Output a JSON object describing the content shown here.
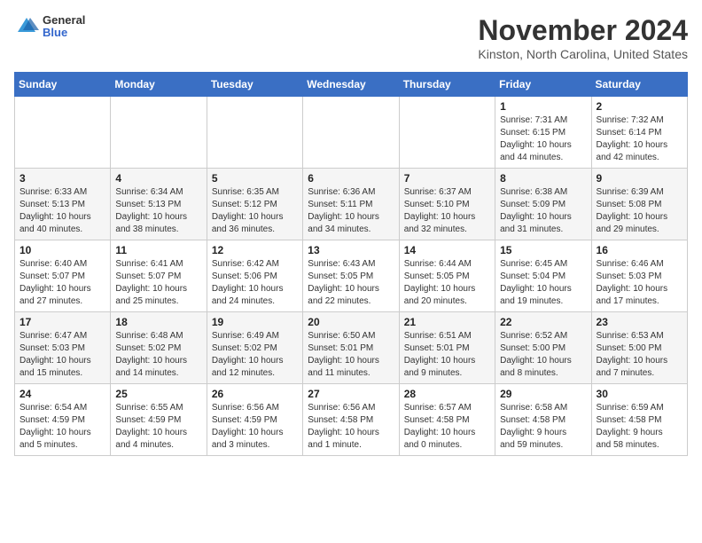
{
  "header": {
    "logo_general": "General",
    "logo_blue": "Blue",
    "title": "November 2024",
    "location": "Kinston, North Carolina, United States"
  },
  "days_of_week": [
    "Sunday",
    "Monday",
    "Tuesday",
    "Wednesday",
    "Thursday",
    "Friday",
    "Saturday"
  ],
  "weeks": [
    [
      {
        "day": "",
        "info": ""
      },
      {
        "day": "",
        "info": ""
      },
      {
        "day": "",
        "info": ""
      },
      {
        "day": "",
        "info": ""
      },
      {
        "day": "",
        "info": ""
      },
      {
        "day": "1",
        "info": "Sunrise: 7:31 AM\nSunset: 6:15 PM\nDaylight: 10 hours\nand 44 minutes."
      },
      {
        "day": "2",
        "info": "Sunrise: 7:32 AM\nSunset: 6:14 PM\nDaylight: 10 hours\nand 42 minutes."
      }
    ],
    [
      {
        "day": "3",
        "info": "Sunrise: 6:33 AM\nSunset: 5:13 PM\nDaylight: 10 hours\nand 40 minutes."
      },
      {
        "day": "4",
        "info": "Sunrise: 6:34 AM\nSunset: 5:13 PM\nDaylight: 10 hours\nand 38 minutes."
      },
      {
        "day": "5",
        "info": "Sunrise: 6:35 AM\nSunset: 5:12 PM\nDaylight: 10 hours\nand 36 minutes."
      },
      {
        "day": "6",
        "info": "Sunrise: 6:36 AM\nSunset: 5:11 PM\nDaylight: 10 hours\nand 34 minutes."
      },
      {
        "day": "7",
        "info": "Sunrise: 6:37 AM\nSunset: 5:10 PM\nDaylight: 10 hours\nand 32 minutes."
      },
      {
        "day": "8",
        "info": "Sunrise: 6:38 AM\nSunset: 5:09 PM\nDaylight: 10 hours\nand 31 minutes."
      },
      {
        "day": "9",
        "info": "Sunrise: 6:39 AM\nSunset: 5:08 PM\nDaylight: 10 hours\nand 29 minutes."
      }
    ],
    [
      {
        "day": "10",
        "info": "Sunrise: 6:40 AM\nSunset: 5:07 PM\nDaylight: 10 hours\nand 27 minutes."
      },
      {
        "day": "11",
        "info": "Sunrise: 6:41 AM\nSunset: 5:07 PM\nDaylight: 10 hours\nand 25 minutes."
      },
      {
        "day": "12",
        "info": "Sunrise: 6:42 AM\nSunset: 5:06 PM\nDaylight: 10 hours\nand 24 minutes."
      },
      {
        "day": "13",
        "info": "Sunrise: 6:43 AM\nSunset: 5:05 PM\nDaylight: 10 hours\nand 22 minutes."
      },
      {
        "day": "14",
        "info": "Sunrise: 6:44 AM\nSunset: 5:05 PM\nDaylight: 10 hours\nand 20 minutes."
      },
      {
        "day": "15",
        "info": "Sunrise: 6:45 AM\nSunset: 5:04 PM\nDaylight: 10 hours\nand 19 minutes."
      },
      {
        "day": "16",
        "info": "Sunrise: 6:46 AM\nSunset: 5:03 PM\nDaylight: 10 hours\nand 17 minutes."
      }
    ],
    [
      {
        "day": "17",
        "info": "Sunrise: 6:47 AM\nSunset: 5:03 PM\nDaylight: 10 hours\nand 15 minutes."
      },
      {
        "day": "18",
        "info": "Sunrise: 6:48 AM\nSunset: 5:02 PM\nDaylight: 10 hours\nand 14 minutes."
      },
      {
        "day": "19",
        "info": "Sunrise: 6:49 AM\nSunset: 5:02 PM\nDaylight: 10 hours\nand 12 minutes."
      },
      {
        "day": "20",
        "info": "Sunrise: 6:50 AM\nSunset: 5:01 PM\nDaylight: 10 hours\nand 11 minutes."
      },
      {
        "day": "21",
        "info": "Sunrise: 6:51 AM\nSunset: 5:01 PM\nDaylight: 10 hours\nand 9 minutes."
      },
      {
        "day": "22",
        "info": "Sunrise: 6:52 AM\nSunset: 5:00 PM\nDaylight: 10 hours\nand 8 minutes."
      },
      {
        "day": "23",
        "info": "Sunrise: 6:53 AM\nSunset: 5:00 PM\nDaylight: 10 hours\nand 7 minutes."
      }
    ],
    [
      {
        "day": "24",
        "info": "Sunrise: 6:54 AM\nSunset: 4:59 PM\nDaylight: 10 hours\nand 5 minutes."
      },
      {
        "day": "25",
        "info": "Sunrise: 6:55 AM\nSunset: 4:59 PM\nDaylight: 10 hours\nand 4 minutes."
      },
      {
        "day": "26",
        "info": "Sunrise: 6:56 AM\nSunset: 4:59 PM\nDaylight: 10 hours\nand 3 minutes."
      },
      {
        "day": "27",
        "info": "Sunrise: 6:56 AM\nSunset: 4:58 PM\nDaylight: 10 hours\nand 1 minute."
      },
      {
        "day": "28",
        "info": "Sunrise: 6:57 AM\nSunset: 4:58 PM\nDaylight: 10 hours\nand 0 minutes."
      },
      {
        "day": "29",
        "info": "Sunrise: 6:58 AM\nSunset: 4:58 PM\nDaylight: 9 hours\nand 59 minutes."
      },
      {
        "day": "30",
        "info": "Sunrise: 6:59 AM\nSunset: 4:58 PM\nDaylight: 9 hours\nand 58 minutes."
      }
    ]
  ]
}
